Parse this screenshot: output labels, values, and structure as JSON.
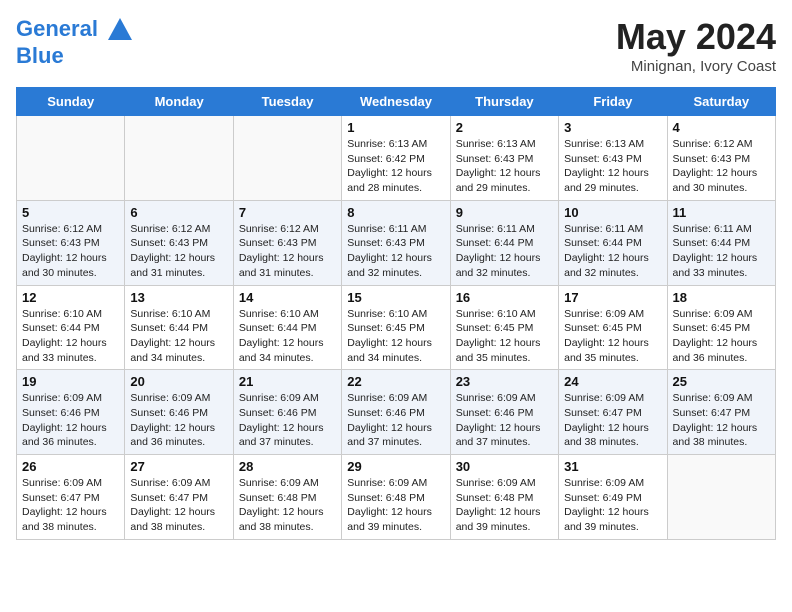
{
  "header": {
    "logo_line1": "General",
    "logo_line2": "Blue",
    "month": "May 2024",
    "location": "Minignan, Ivory Coast"
  },
  "days_of_week": [
    "Sunday",
    "Monday",
    "Tuesday",
    "Wednesday",
    "Thursday",
    "Friday",
    "Saturday"
  ],
  "weeks": [
    [
      {
        "day": "",
        "info": ""
      },
      {
        "day": "",
        "info": ""
      },
      {
        "day": "",
        "info": ""
      },
      {
        "day": "1",
        "info": "Sunrise: 6:13 AM\nSunset: 6:42 PM\nDaylight: 12 hours\nand 28 minutes."
      },
      {
        "day": "2",
        "info": "Sunrise: 6:13 AM\nSunset: 6:43 PM\nDaylight: 12 hours\nand 29 minutes."
      },
      {
        "day": "3",
        "info": "Sunrise: 6:13 AM\nSunset: 6:43 PM\nDaylight: 12 hours\nand 29 minutes."
      },
      {
        "day": "4",
        "info": "Sunrise: 6:12 AM\nSunset: 6:43 PM\nDaylight: 12 hours\nand 30 minutes."
      }
    ],
    [
      {
        "day": "5",
        "info": "Sunrise: 6:12 AM\nSunset: 6:43 PM\nDaylight: 12 hours\nand 30 minutes."
      },
      {
        "day": "6",
        "info": "Sunrise: 6:12 AM\nSunset: 6:43 PM\nDaylight: 12 hours\nand 31 minutes."
      },
      {
        "day": "7",
        "info": "Sunrise: 6:12 AM\nSunset: 6:43 PM\nDaylight: 12 hours\nand 31 minutes."
      },
      {
        "day": "8",
        "info": "Sunrise: 6:11 AM\nSunset: 6:43 PM\nDaylight: 12 hours\nand 32 minutes."
      },
      {
        "day": "9",
        "info": "Sunrise: 6:11 AM\nSunset: 6:44 PM\nDaylight: 12 hours\nand 32 minutes."
      },
      {
        "day": "10",
        "info": "Sunrise: 6:11 AM\nSunset: 6:44 PM\nDaylight: 12 hours\nand 32 minutes."
      },
      {
        "day": "11",
        "info": "Sunrise: 6:11 AM\nSunset: 6:44 PM\nDaylight: 12 hours\nand 33 minutes."
      }
    ],
    [
      {
        "day": "12",
        "info": "Sunrise: 6:10 AM\nSunset: 6:44 PM\nDaylight: 12 hours\nand 33 minutes."
      },
      {
        "day": "13",
        "info": "Sunrise: 6:10 AM\nSunset: 6:44 PM\nDaylight: 12 hours\nand 34 minutes."
      },
      {
        "day": "14",
        "info": "Sunrise: 6:10 AM\nSunset: 6:44 PM\nDaylight: 12 hours\nand 34 minutes."
      },
      {
        "day": "15",
        "info": "Sunrise: 6:10 AM\nSunset: 6:45 PM\nDaylight: 12 hours\nand 34 minutes."
      },
      {
        "day": "16",
        "info": "Sunrise: 6:10 AM\nSunset: 6:45 PM\nDaylight: 12 hours\nand 35 minutes."
      },
      {
        "day": "17",
        "info": "Sunrise: 6:09 AM\nSunset: 6:45 PM\nDaylight: 12 hours\nand 35 minutes."
      },
      {
        "day": "18",
        "info": "Sunrise: 6:09 AM\nSunset: 6:45 PM\nDaylight: 12 hours\nand 36 minutes."
      }
    ],
    [
      {
        "day": "19",
        "info": "Sunrise: 6:09 AM\nSunset: 6:46 PM\nDaylight: 12 hours\nand 36 minutes."
      },
      {
        "day": "20",
        "info": "Sunrise: 6:09 AM\nSunset: 6:46 PM\nDaylight: 12 hours\nand 36 minutes."
      },
      {
        "day": "21",
        "info": "Sunrise: 6:09 AM\nSunset: 6:46 PM\nDaylight: 12 hours\nand 37 minutes."
      },
      {
        "day": "22",
        "info": "Sunrise: 6:09 AM\nSunset: 6:46 PM\nDaylight: 12 hours\nand 37 minutes."
      },
      {
        "day": "23",
        "info": "Sunrise: 6:09 AM\nSunset: 6:46 PM\nDaylight: 12 hours\nand 37 minutes."
      },
      {
        "day": "24",
        "info": "Sunrise: 6:09 AM\nSunset: 6:47 PM\nDaylight: 12 hours\nand 38 minutes."
      },
      {
        "day": "25",
        "info": "Sunrise: 6:09 AM\nSunset: 6:47 PM\nDaylight: 12 hours\nand 38 minutes."
      }
    ],
    [
      {
        "day": "26",
        "info": "Sunrise: 6:09 AM\nSunset: 6:47 PM\nDaylight: 12 hours\nand 38 minutes."
      },
      {
        "day": "27",
        "info": "Sunrise: 6:09 AM\nSunset: 6:47 PM\nDaylight: 12 hours\nand 38 minutes."
      },
      {
        "day": "28",
        "info": "Sunrise: 6:09 AM\nSunset: 6:48 PM\nDaylight: 12 hours\nand 38 minutes."
      },
      {
        "day": "29",
        "info": "Sunrise: 6:09 AM\nSunset: 6:48 PM\nDaylight: 12 hours\nand 39 minutes."
      },
      {
        "day": "30",
        "info": "Sunrise: 6:09 AM\nSunset: 6:48 PM\nDaylight: 12 hours\nand 39 minutes."
      },
      {
        "day": "31",
        "info": "Sunrise: 6:09 AM\nSunset: 6:49 PM\nDaylight: 12 hours\nand 39 minutes."
      },
      {
        "day": "",
        "info": ""
      }
    ]
  ]
}
